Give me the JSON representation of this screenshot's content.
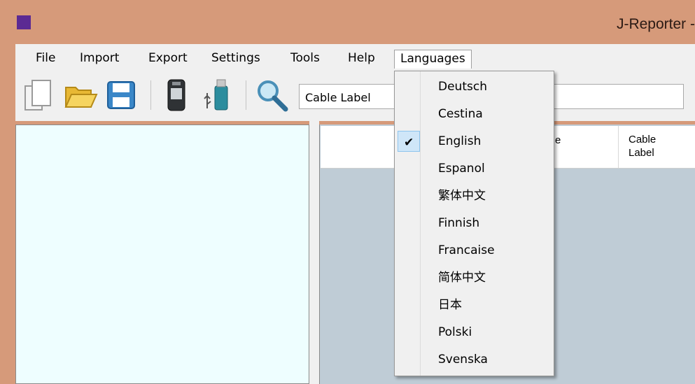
{
  "window": {
    "title": "J-Reporter -",
    "colors": {
      "titlebar": "#d69a7a",
      "app_icon": "#5b2a93",
      "left_pane_bg": "#eefeff",
      "right_pane_bg": "#bfccd6",
      "check_highlight": "#cfe6f8"
    }
  },
  "menubar": {
    "items": [
      {
        "label": "File"
      },
      {
        "label": "Import"
      },
      {
        "label": "Export"
      },
      {
        "label": "Settings"
      },
      {
        "label": "Tools"
      },
      {
        "label": "Help"
      },
      {
        "label": "Languages"
      }
    ]
  },
  "toolbar": {
    "icons": [
      "new-document-icon",
      "open-folder-icon",
      "save-disk-icon",
      "handheld-device-icon",
      "usb-drive-icon",
      "magnifier-search-icon"
    ],
    "combo_value": "Cable Label",
    "search_value": ""
  },
  "grid": {
    "partial_column_fragment": "e",
    "cable_label_header": [
      "Cable",
      "Label"
    ]
  },
  "languages_menu": {
    "items": [
      {
        "label": "Deutsch",
        "checked": false
      },
      {
        "label": "Cestina",
        "checked": false
      },
      {
        "label": "English",
        "checked": true,
        "check_glyph": "✔"
      },
      {
        "label": "Espanol",
        "checked": false
      },
      {
        "label": "繁体中文",
        "checked": false
      },
      {
        "label": "Finnish",
        "checked": false
      },
      {
        "label": "Francaise",
        "checked": false
      },
      {
        "label": "简体中文",
        "checked": false
      },
      {
        "label": "日本",
        "checked": false
      },
      {
        "label": "Polski",
        "checked": false
      },
      {
        "label": "Svenska",
        "checked": false
      }
    ]
  }
}
